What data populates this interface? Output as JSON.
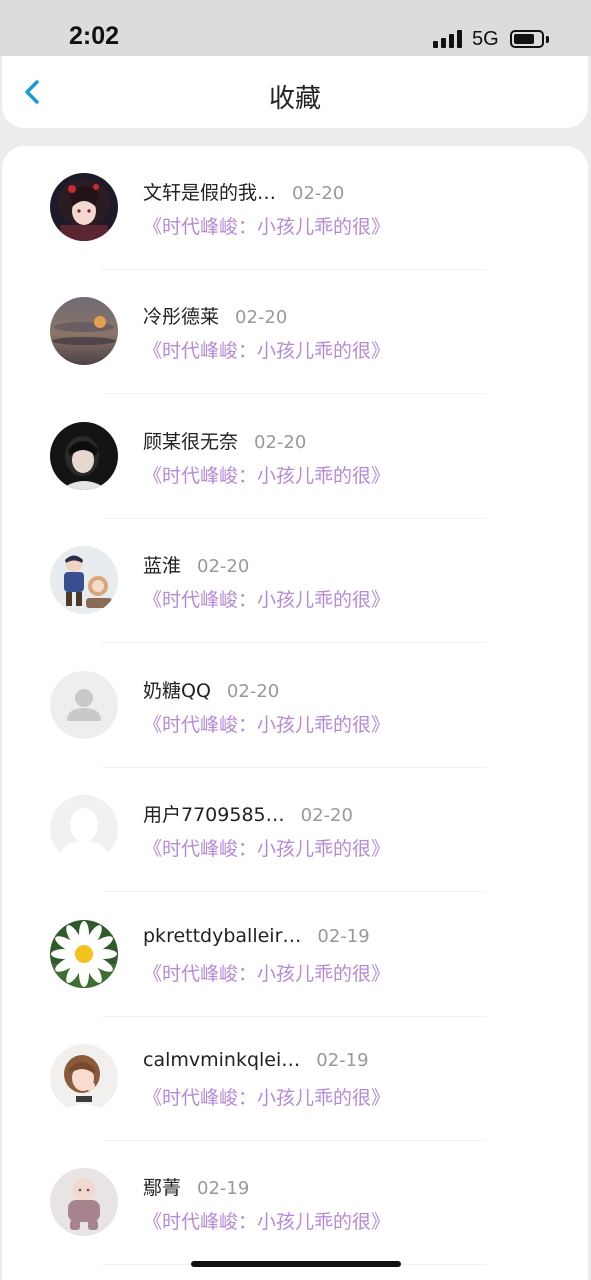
{
  "status_bar": {
    "time": "2:02",
    "network": "5G",
    "battery": 0.75
  },
  "nav": {
    "title": "收藏",
    "back_icon": "chevron-left-icon"
  },
  "colors": {
    "accent": "#1a9bd7",
    "favorite_title": "#b78ad8",
    "date": "#999999"
  },
  "favorites": [
    {
      "name": "文轩是假的我…",
      "date": "02-20",
      "title": "《时代峰峻：小孩儿乖的很》",
      "avatar": "anime-girl"
    },
    {
      "name": "冷彤德莱",
      "date": "02-20",
      "title": "《时代峰峻：小孩儿乖的很》",
      "avatar": "sunset"
    },
    {
      "name": "顾某很无奈",
      "date": "02-20",
      "title": "《时代峰峻：小孩儿乖的很》",
      "avatar": "person-dark"
    },
    {
      "name": "蓝淮",
      "date": "02-20",
      "title": "《时代峰峻：小孩儿乖的很》",
      "avatar": "illustration"
    },
    {
      "name": "奶糖QQ",
      "date": "02-20",
      "title": "《时代峰峻：小孩儿乖的很》",
      "avatar": "default-gray"
    },
    {
      "name": "用户7709585…",
      "date": "02-20",
      "title": "《时代峰峻：小孩儿乖的很》",
      "avatar": "default-white"
    },
    {
      "name": "pkrettdyballeir…",
      "date": "02-19",
      "title": "《时代峰峻：小孩儿乖的很》",
      "avatar": "daisy"
    },
    {
      "name": "calmvminkqlei…",
      "date": "02-19",
      "title": "《时代峰峻：小孩儿乖的很》",
      "avatar": "girl-photo"
    },
    {
      "name": "鄢菁",
      "date": "02-19",
      "title": "《时代峰峻：小孩儿乖的很》",
      "avatar": "baby"
    }
  ]
}
